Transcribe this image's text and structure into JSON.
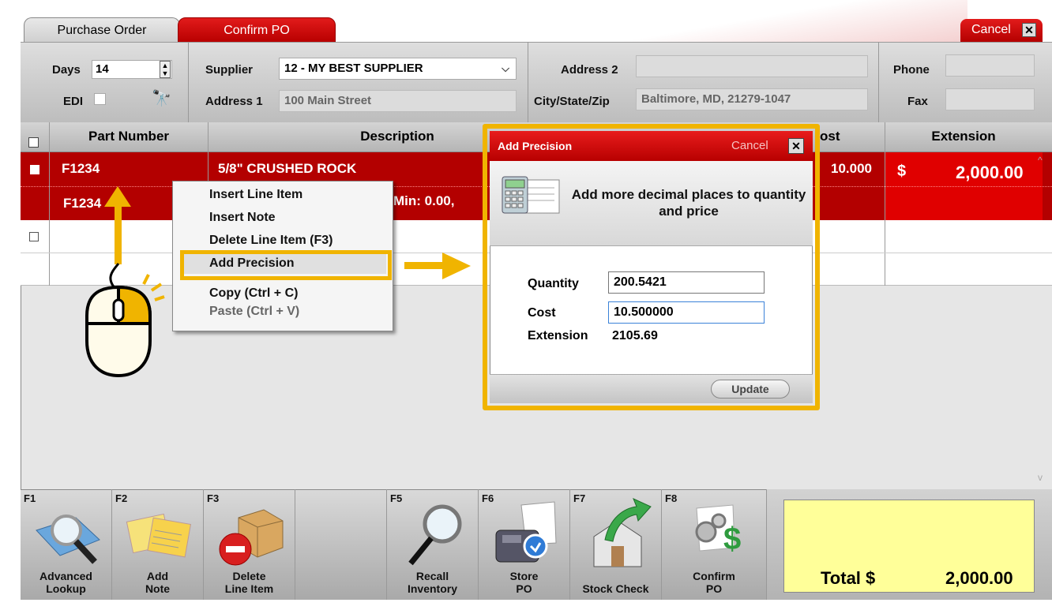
{
  "tabs": {
    "purchase_order": "Purchase Order",
    "confirm_po": "Confirm PO"
  },
  "top_cancel": "Cancel",
  "header": {
    "days_label": "Days",
    "days_value": "14",
    "edi_label": "EDI",
    "supplier_label": "Supplier",
    "supplier_value": "12 - MY BEST SUPPLIER",
    "address1_label": "Address 1",
    "address1_value": "100 Main Street",
    "address2_label": "Address 2",
    "address2_value": "",
    "city_label": "City/State/Zip",
    "city_value": "Baltimore, MD, 21279-1047",
    "phone_label": "Phone",
    "fax_label": "Fax"
  },
  "grid": {
    "columns": [
      "Part Number",
      "Description",
      "ost",
      "Extension"
    ],
    "rows": [
      {
        "part": "F1234",
        "part2": "F1234",
        "description": "5/8\" CRUSHED ROCK",
        "desc2": "Min: 0.00,",
        "cost": "10.000",
        "ext_symbol": "$",
        "extension": "2,000.00"
      }
    ]
  },
  "context_menu": {
    "items": [
      "Insert Line Item",
      "Insert Note",
      "Delete Line Item (F3)",
      "Add Precision",
      "Copy (Ctrl + C)",
      "Paste (Ctrl + V)"
    ]
  },
  "dialog": {
    "title": "Add Precision",
    "cancel": "Cancel",
    "heading": "Add more decimal places to quantity and price",
    "quantity_label": "Quantity",
    "quantity_value": "200.5421",
    "cost_label": "Cost",
    "cost_value": "10.500000",
    "extension_label": "Extension",
    "extension_value": "2105.69",
    "update": "Update"
  },
  "toolbar": [
    {
      "key": "F1",
      "label1": "Advanced",
      "label2": "Lookup",
      "icon": "magnifier-folder-icon"
    },
    {
      "key": "F2",
      "label1": "Add",
      "label2": "Note",
      "icon": "sticky-notes-icon"
    },
    {
      "key": "F3",
      "label1": "Delete",
      "label2": "Line Item",
      "icon": "box-delete-icon"
    },
    {
      "key": "",
      "label1": "",
      "label2": "",
      "icon": ""
    },
    {
      "key": "F5",
      "label1": "Recall",
      "label2": "Inventory",
      "icon": "magnifier-icon"
    },
    {
      "key": "F6",
      "label1": "Store",
      "label2": "PO",
      "icon": "store-fax-icon"
    },
    {
      "key": "F7",
      "label1": "",
      "label2": "Stock Check",
      "icon": "house-arrow-icon"
    },
    {
      "key": "F8",
      "label1": "Confirm",
      "label2": "PO",
      "icon": "gears-dollar-icon"
    }
  ],
  "total": {
    "label": "Total $",
    "value": "2,000.00"
  },
  "colors": {
    "accent_red": "#c00000",
    "highlight": "#f0b400",
    "total_bg": "#ffff99"
  }
}
